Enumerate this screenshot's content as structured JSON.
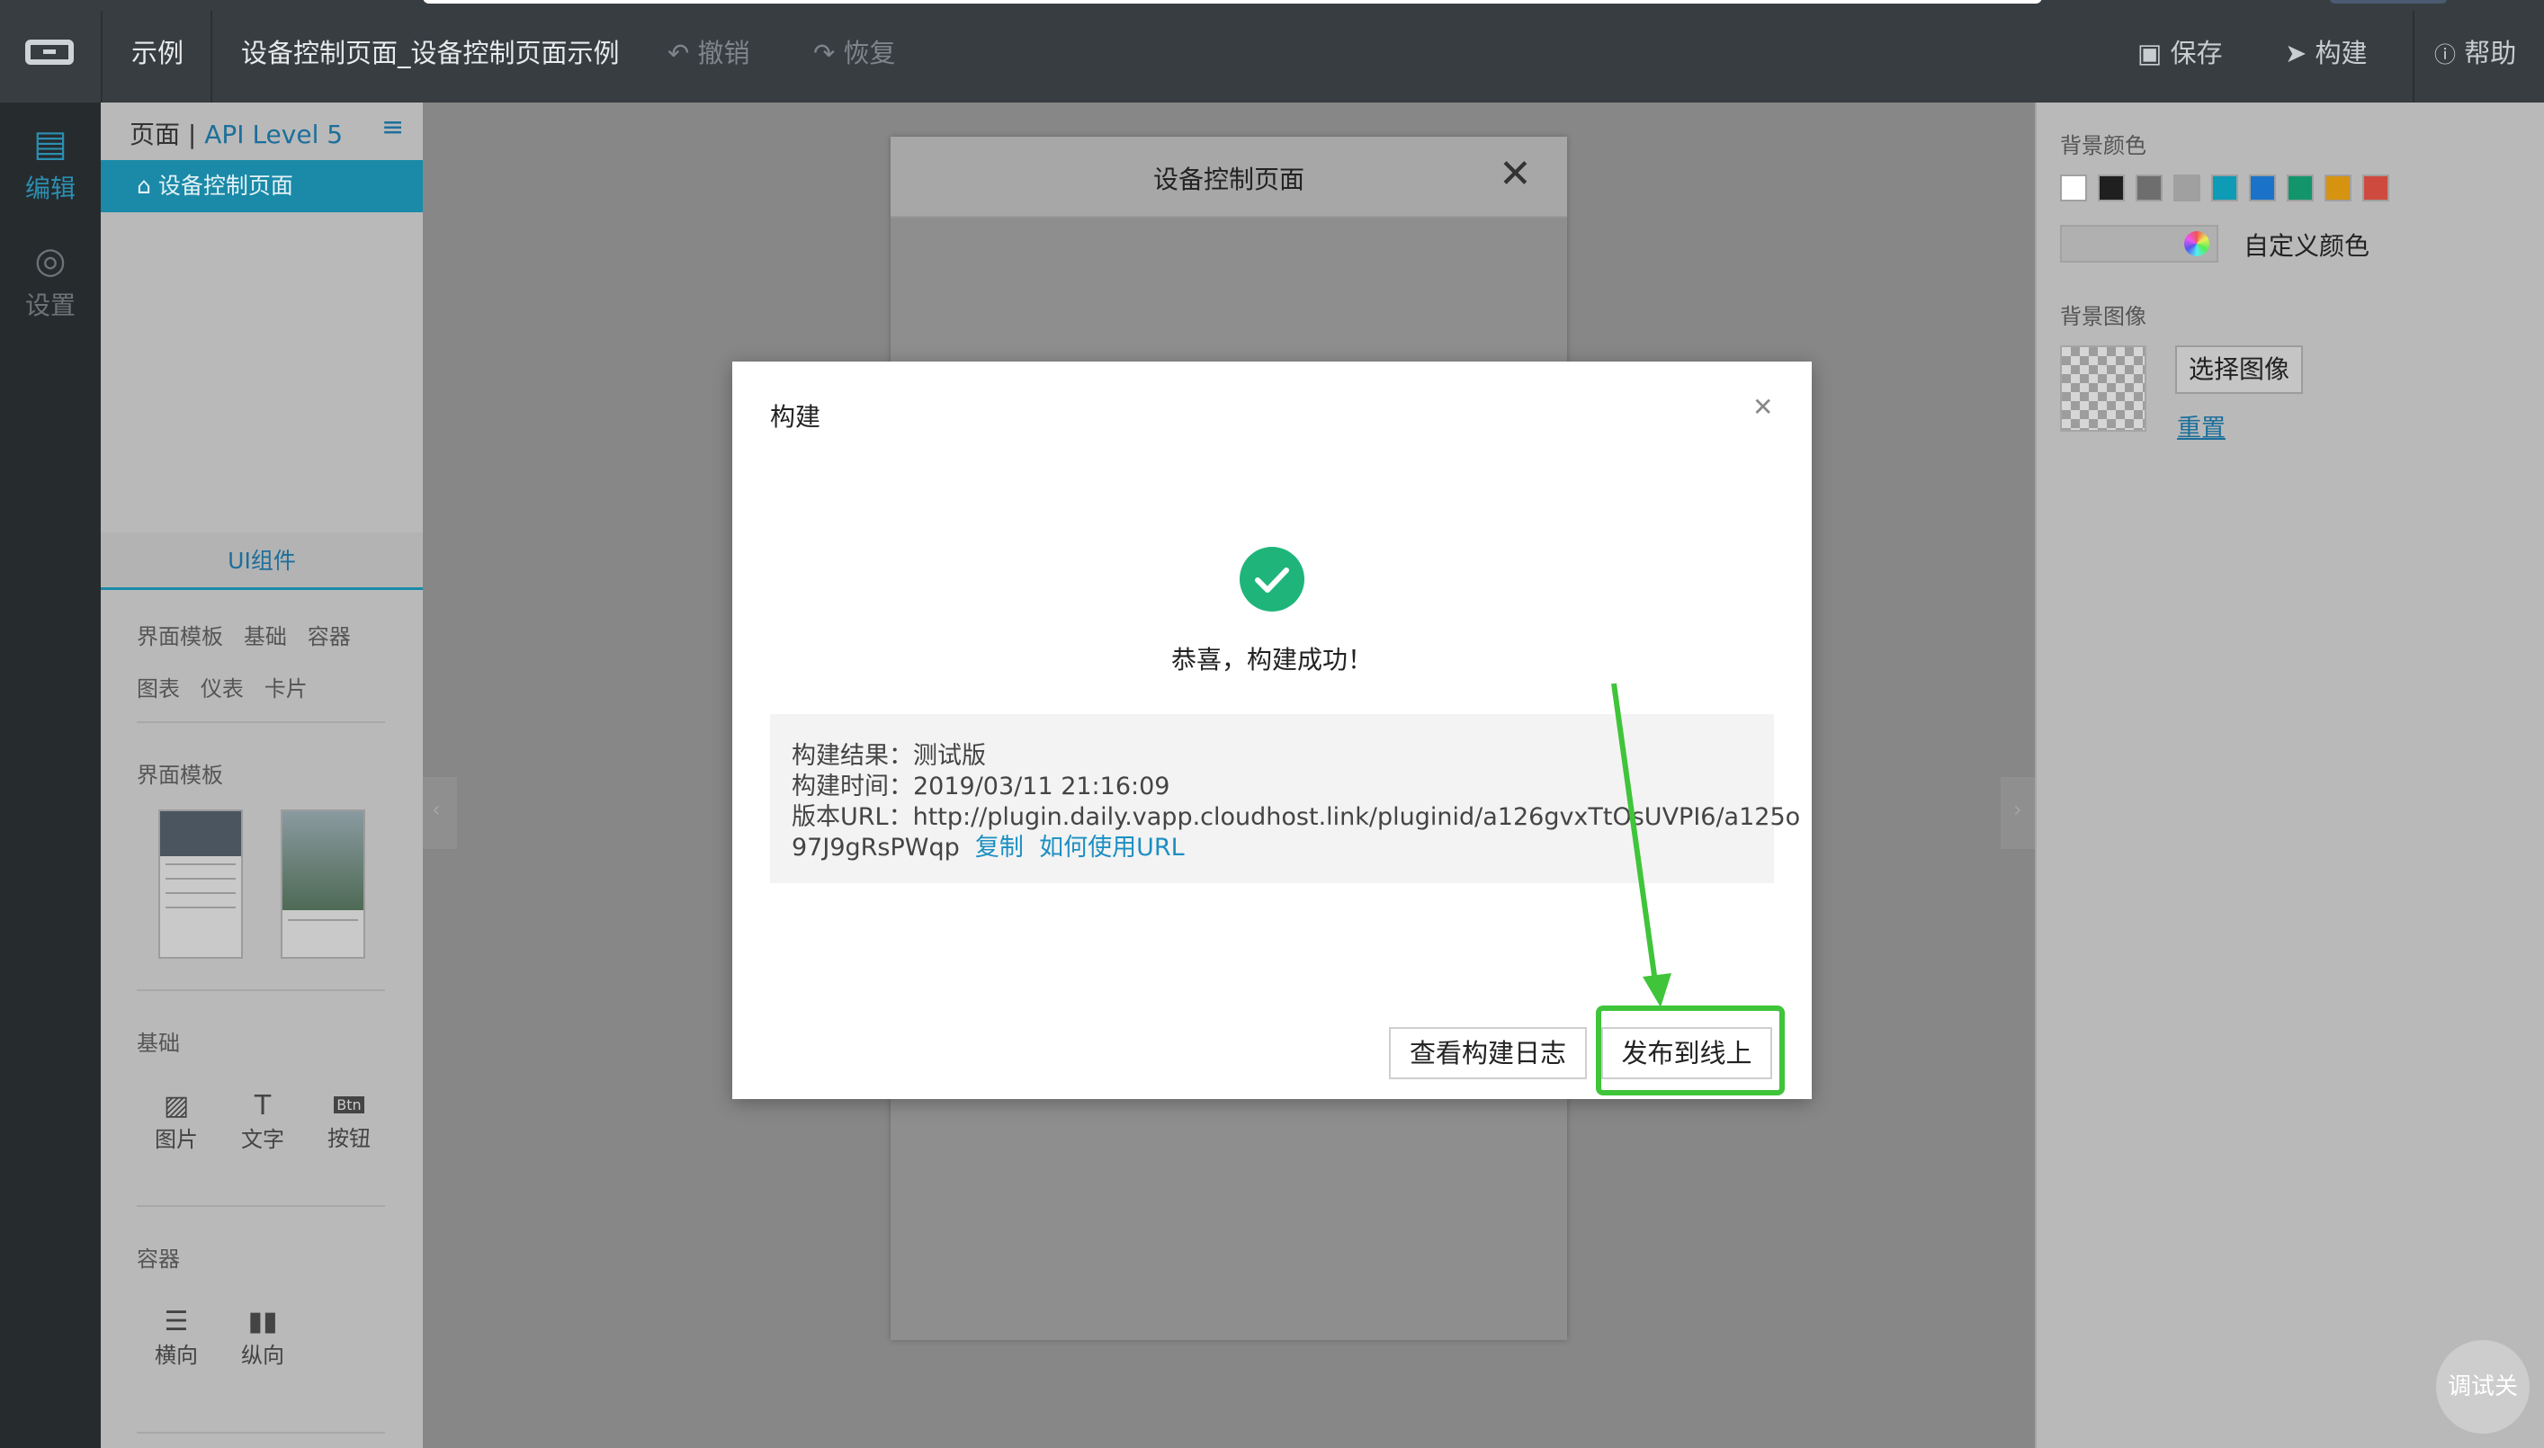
{
  "topbar": {
    "example": "示例",
    "page_title": "设备控制页面_设备控制页面示例",
    "undo": "撤销",
    "redo": "恢复",
    "save": "保存",
    "build": "构建",
    "help": "帮助"
  },
  "rail": {
    "edit": "编辑",
    "settings": "设置"
  },
  "left_panel": {
    "page_label": "页面",
    "api_level": "API Level 5",
    "active_page": "设备控制页面",
    "components_tab": "UI组件",
    "categories_row1": [
      "界面模板",
      "基础",
      "容器"
    ],
    "categories_row2": [
      "图表",
      "仪表",
      "卡片"
    ],
    "section_templates": "界面模板",
    "section_basic": "基础",
    "basic_items": [
      "图片",
      "文字",
      "按钮"
    ],
    "btn_glyph": "Btn",
    "section_container": "容器",
    "container_items": [
      "横向",
      "纵向"
    ]
  },
  "phone": {
    "title": "设备控制页面"
  },
  "right_panel": {
    "bg_color_label": "背景颜色",
    "swatch_colors": [
      "#ffffff",
      "#1f1f1f",
      "#6e6e6e",
      "#a0a0a0",
      "#0d9bb5",
      "#1a73c8",
      "#13956b",
      "#d59310",
      "#cf4a3e"
    ],
    "custom_color_label": "自定义颜色",
    "bg_image_label": "背景图像",
    "choose_image": "选择图像",
    "reset": "重置"
  },
  "modal": {
    "title": "构建",
    "success_text": "恭喜，构建成功！",
    "result_label": "构建结果：",
    "result_value": "测试版",
    "time_label": "构建时间：",
    "time_value": "2019/03/11 21:16:09",
    "url_label": "版本URL：",
    "url_line1": "http://plugin.daily.vapp.cloudhost.link/pluginid/a126gvxTtOsUVPI6/a125o",
    "url_line2": "97J9gRsPWqp",
    "copy_link": "复制",
    "how_to_link": "如何使用URL",
    "view_log_button": "查看构建日志",
    "publish_button": "发布到线上"
  },
  "debug_toggle": "调试关",
  "annotation_color": "#3fc43a"
}
